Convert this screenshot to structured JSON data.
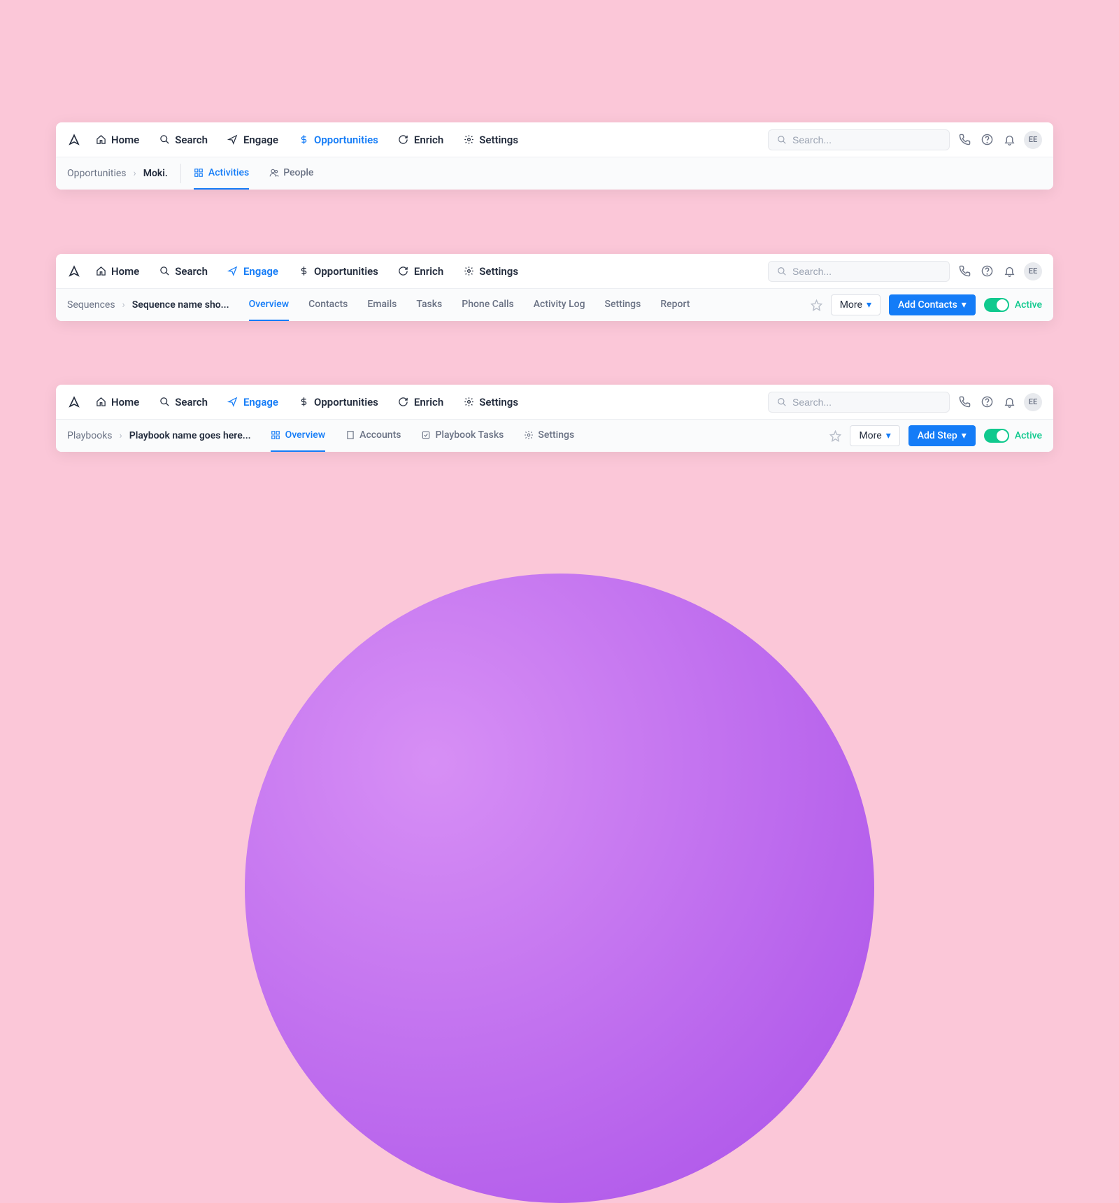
{
  "nav": {
    "home": "Home",
    "search": "Search",
    "engage": "Engage",
    "opportunities": "Opportunities",
    "enrich": "Enrich",
    "settings": "Settings"
  },
  "search_placeholder": "Search...",
  "avatar": "EE",
  "card1": {
    "bc1": "Opportunities",
    "bc2": "Moki.",
    "tab_activities": "Activities",
    "tab_people": "People"
  },
  "card2": {
    "bc1": "Sequences",
    "bc2": "Sequence name sho...",
    "tab_overview": "Overview",
    "tab_contacts": "Contacts",
    "tab_emails": "Emails",
    "tab_tasks": "Tasks",
    "tab_phone": "Phone Calls",
    "tab_activity": "Activity Log",
    "tab_settings": "Settings",
    "tab_report": "Report",
    "more": "More",
    "add_contacts": "Add Contacts",
    "active": "Active"
  },
  "card3": {
    "bc1": "Playbooks",
    "bc2": "Playbook name goes here...",
    "tab_overview": "Overview",
    "tab_accounts": "Accounts",
    "tab_tasks": "Playbook Tasks",
    "tab_settings": "Settings",
    "more": "More",
    "add_step": "Add Step",
    "active": "Active"
  }
}
